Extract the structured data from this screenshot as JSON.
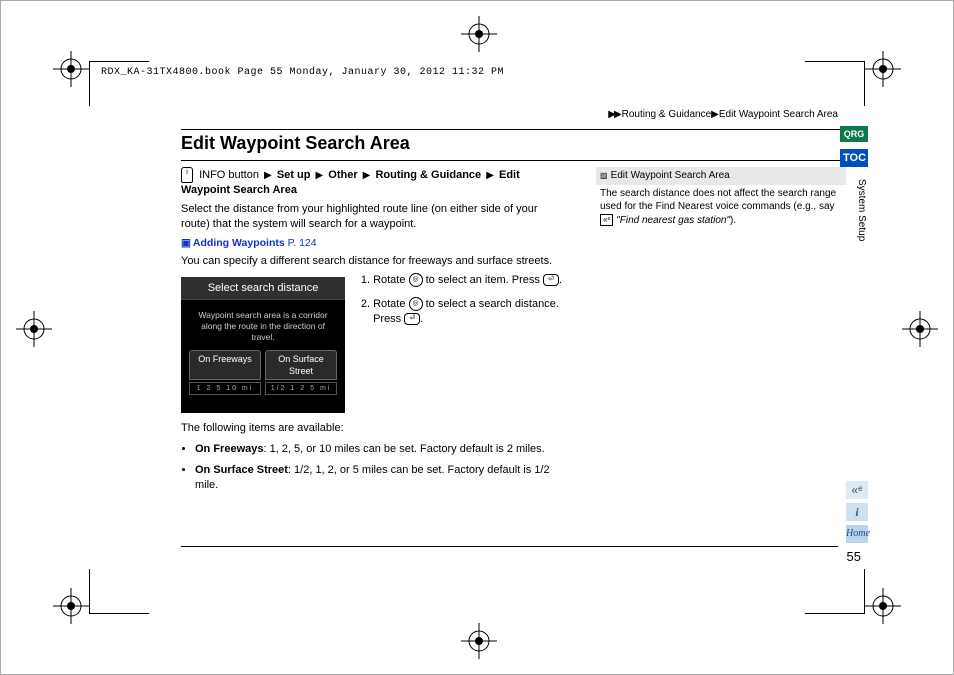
{
  "header_stamp": "RDX_KA-31TX4800.book  Page 55  Monday, January 30, 2012  11:32 PM",
  "breadcrumb_top": {
    "section": "Routing & Guidance",
    "page": "Edit Waypoint Search Area"
  },
  "title": "Edit Waypoint Search Area",
  "nav_path": {
    "prefix": "INFO button",
    "step1": "Set up",
    "step2": "Other",
    "step3": "Routing & Guidance",
    "step4": "Edit Waypoint Search Area"
  },
  "intro": "Select the distance from your highlighted route line (on either side of your route) that the system will search for a waypoint.",
  "link": {
    "label": "Adding Waypoints",
    "page_prefix": "P.",
    "page": "124"
  },
  "sentence2": "You can specify a different search distance for freeways and surface streets.",
  "screenshot": {
    "title": "Select search distance",
    "desc": "Waypoint search area is a corridor along the route in the direction of travel.",
    "tab1": "On Freeways",
    "tab2": "On Surface Street",
    "scale1": "1 2 5 10 mi",
    "scale2": "1/2 1 2 5 mi"
  },
  "steps": {
    "s1a": "Rotate ",
    "s1b": " to select an item. Press ",
    "s1c": ".",
    "s2a": "Rotate ",
    "s2b": " to select a search distance. Press ",
    "s2c": "."
  },
  "after": "The following items are available:",
  "bullets": {
    "b1_label": "On Freeways",
    "b1_text": ": 1, 2, 5, or 10 miles can be set. Factory default is 2 miles.",
    "b2_label": "On Surface Street",
    "b2_text": ": 1/2, 1, 2, or 5 miles can be set. Factory default is 1/2 mile."
  },
  "sidenote": {
    "head": "Edit Waypoint Search Area",
    "body1": "The search distance does not affect the search range used for the Find Nearest voice commands (e.g., say ",
    "body_italic": "\"Find nearest gas station\"",
    "body2": ")."
  },
  "side_tabs": {
    "qrg": "QRG",
    "toc": "TOC",
    "section_label": "System Setup"
  },
  "side_icons": {
    "voice": "✦",
    "info": "i",
    "home": "Home"
  },
  "page_number": "55"
}
